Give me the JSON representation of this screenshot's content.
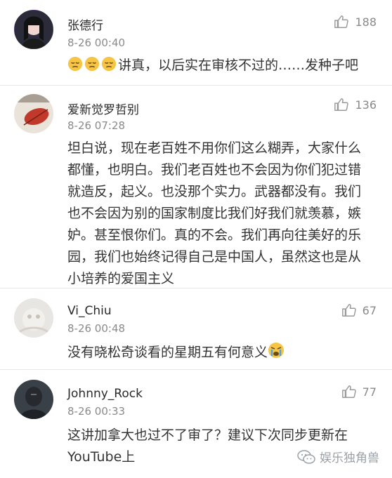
{
  "comments": [
    {
      "name": "张德行",
      "time": "8-26 00:40",
      "likes": "188",
      "text": "讲真，以后实在审核不过的……发种子吧",
      "emoji_before": [
        "pensive-face-icon",
        "pensive-face-icon",
        "pensive-face-icon"
      ]
    },
    {
      "name": "爱新觉罗哲别",
      "time": "8-26 07:28",
      "likes": "136",
      "lines": [
        "坦白说，现在老百姓不用你们这么糊弄，大家什么",
        "都懂，也明白。我们老百姓也不会因为你们犯过错",
        "就造反，起义。也没那个实力。武器都没有。我们",
        "也不会因为别的国家制度比我们好我们就羡慕，嫉",
        "妒。甚至恨你们。真的不会。我们再向往美好的乐",
        "园，我们也始终记得自己是中国人，虽然这也是从",
        "小培养的爱国主义"
      ]
    },
    {
      "name": "Vi_Chiu",
      "time": "8-26 00:48",
      "likes": "67",
      "text": "没有晓松奇谈看的星期五有何意义",
      "emoji_after": "crying-face-icon"
    },
    {
      "name": "Johnny_Rock",
      "time": "8-26 00:33",
      "likes": "77",
      "lines": [
        "这讲加拿大也过不了审了？建议下次同步更新在",
        "YouTube上"
      ]
    }
  ],
  "watermark": {
    "label": "娱乐独角兽",
    "icon": "wechat-icon"
  },
  "colors": {
    "name": "#2a2a2a",
    "meta": "#8a8a8a",
    "body": "#333333",
    "divider": "#e6e6e6"
  }
}
